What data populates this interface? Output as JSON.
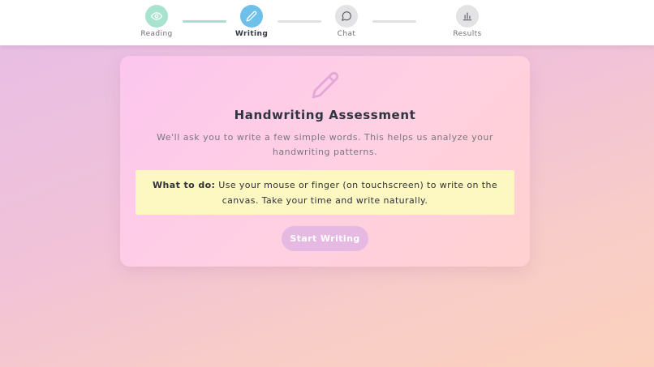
{
  "progress": {
    "steps": [
      {
        "label": "Reading",
        "state": "done",
        "icon": "eye-icon"
      },
      {
        "label": "Writing",
        "state": "active",
        "icon": "pencil-icon"
      },
      {
        "label": "Chat",
        "state": "todo",
        "icon": "chat-bubble-icon"
      },
      {
        "label": "Results",
        "state": "todo",
        "icon": "bar-chart-icon"
      }
    ]
  },
  "card": {
    "icon": "pencil-icon",
    "title": "Handwriting Assessment",
    "description": "We'll ask you to write a few simple words. This helps us analyze your handwriting patterns.",
    "note_label": "What to do:",
    "note_text": " Use your mouse or finger (on touchscreen) to write on the canvas. Take your time and write naturally.",
    "button_label": "Start Writing"
  },
  "colors": {
    "done": "#a8e3cf",
    "active": "#6cc0ea",
    "todo": "#e3e3e6",
    "note_bg": "#fdf8c2",
    "button_bg": "#e5b9e2"
  }
}
